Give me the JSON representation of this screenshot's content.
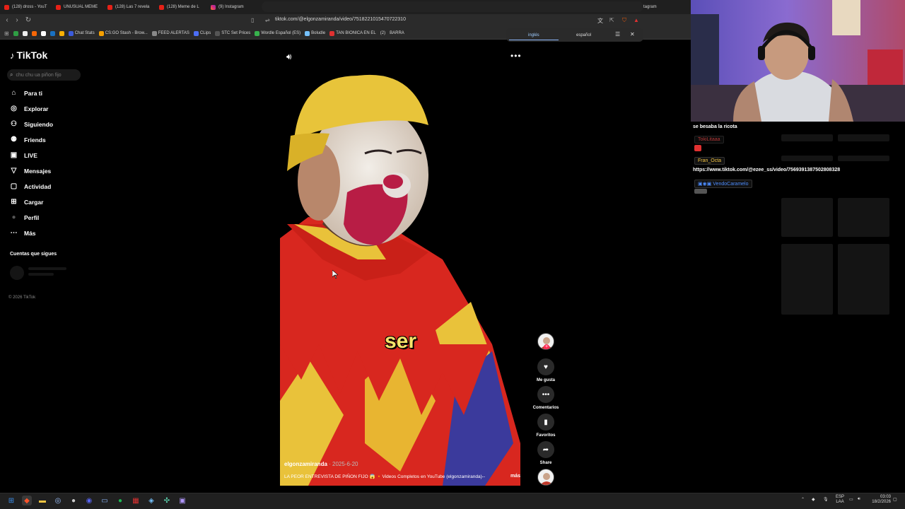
{
  "browser": {
    "tabs": [
      {
        "label": "(128) dross - YouT",
        "kind": "yt"
      },
      {
        "label": "UNUSUAL MEME",
        "kind": "yt"
      },
      {
        "label": "(128) Las 7 revela",
        "kind": "yt"
      },
      {
        "label": "(128) Meme de L",
        "kind": "yt"
      },
      {
        "label": "(9) Instagram",
        "kind": "ig"
      },
      {
        "label": "(9) Instagram",
        "kind": "ig"
      },
      {
        "label": "(9) Instagram",
        "kind": "ig"
      },
      {
        "label": "(9) Instagram",
        "kind": "ig"
      },
      {
        "label": "(9) Instagram",
        "kind": "ig"
      },
      {
        "label": "(9) Instagram",
        "kind": "ig"
      },
      {
        "label": "(9) Instagram",
        "kind": "ig"
      },
      {
        "label": "(9) Instagram",
        "kind": "ig"
      },
      {
        "label": "(9) Instagram",
        "kind": "ig"
      }
    ],
    "url": "tiktok.com/@elgonzamiranda/video/7518221015470722310",
    "bookmarks": [
      {
        "label": "Chat Stats",
        "color": "#3b5bdb"
      },
      {
        "label": "CS:GO Stash - Brow...",
        "color": "#f59f00"
      },
      {
        "label": "FEED ALERTAS",
        "color": "#888888"
      },
      {
        "label": "CLips",
        "color": "#4c6ef5"
      },
      {
        "label": "STC Set Prices",
        "color": "#555555"
      },
      {
        "label": "Wordle Español (ES)",
        "color": "#37b24d"
      },
      {
        "label": "Boludle",
        "color": "#74c0fc"
      },
      {
        "label": "TAN BIONICA EN EL",
        "color": "#e03131"
      }
    ],
    "bookmarks_tail": [
      "(2)",
      "BARRA"
    ],
    "translate": {
      "source": "inglés",
      "target": "español"
    }
  },
  "tiktok": {
    "logo": "TikTok",
    "search_placeholder": "chu chu ua piñon fijo",
    "nav": [
      {
        "label": "Para ti",
        "icon": "home-icon"
      },
      {
        "label": "Explorar",
        "icon": "compass-icon"
      },
      {
        "label": "Siguiendo",
        "icon": "user-follow-icon"
      },
      {
        "label": "Friends",
        "icon": "friends-icon"
      },
      {
        "label": "LIVE",
        "icon": "live-icon"
      },
      {
        "label": "Mensajes",
        "icon": "messages-icon"
      },
      {
        "label": "Actividad",
        "icon": "activity-icon"
      },
      {
        "label": "Cargar",
        "icon": "upload-icon"
      },
      {
        "label": "Perfil",
        "icon": "profile-avatar-icon"
      },
      {
        "label": "Más",
        "icon": "more-dots-icon"
      }
    ],
    "following_title": "Cuentas que sigues",
    "copyright": "© 2026 TikTok",
    "video": {
      "caption_word": "ser",
      "author": "elgonzamiranda",
      "date": "· 2025-6-20",
      "description": "LA PEOR ENTREVISTA DE PIÑON FIJO 😱 🔸Videos Completos en YouTube (elgonzamiranda)--",
      "more": "más"
    },
    "actions": {
      "like": "Me gusta",
      "comments": "Comentarios",
      "favorites": "Favoritos",
      "share": "Share"
    }
  },
  "chat": {
    "line1": "se besaba la ricota",
    "user1": "TokiLitaaa",
    "user2": "Fran_Octa",
    "link": "https://www.tiktok.com/@ezee_ss/video/7569391387502808328",
    "user3": "VendoCaramelo"
  },
  "taskbar": {
    "lang": "ESP",
    "lang_sub": "LAA",
    "time": "03:03",
    "date": "18/2/2026"
  },
  "colors": {
    "tiktok_red": "#fe2c55",
    "caption_yellow": "#f8e36a",
    "chat_user1": "#ff4d4d",
    "chat_user2": "#f5c542",
    "chat_user3": "#4d8dff"
  }
}
